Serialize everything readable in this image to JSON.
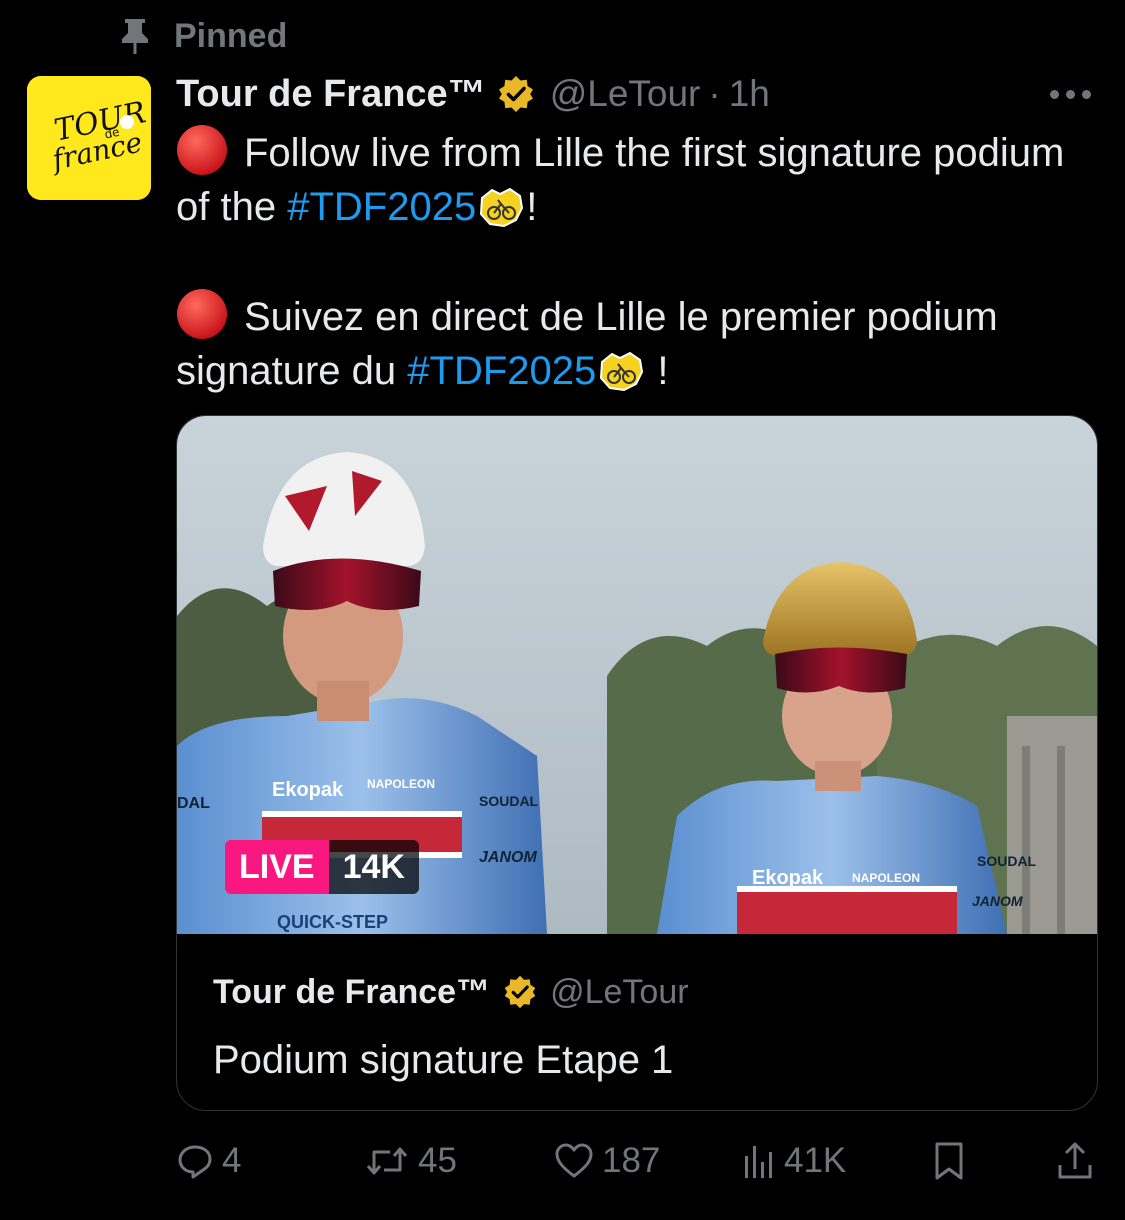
{
  "pinned": {
    "label": "Pinned",
    "icon": "pin-icon"
  },
  "author": {
    "name": "Tour de France™",
    "handle": "@LeTour",
    "separator": "·",
    "time": "1h",
    "verified_color": "#e8b828",
    "avatar_bg": "#ffe81c",
    "avatar_logo_lines": [
      "TOUR",
      "de",
      "france"
    ]
  },
  "tweet": {
    "line1_text": "Follow live from Lille the first signature podium of the ",
    "line1_tag": "#TDF2025",
    "line1_end": "!",
    "line2_text": "Suivez en direct de Lille le premier podium signature du ",
    "line2_tag": "#TDF2025",
    "line2_end": " !",
    "hashtag_color": "#1d9bf0"
  },
  "card": {
    "live_label": "LIVE",
    "viewer_count": "14K",
    "author": "Tour de France™",
    "handle": "@LeTour",
    "title": "Podium signature Etape 1",
    "live_color": "#f91880",
    "jersey_texts": {
      "sponsor_left": "Ekopak",
      "sponsor_napoleon": "NAPOLEON",
      "sponsor_soudal": "SOUDAL",
      "sponsor_janom": "JANOM",
      "sponsor_quickstep": "QUICK-STEP",
      "sponsor_dal": "DAL",
      "sponsor_ekopak_right": "Ekopak",
      "sponsor_napoleon_right": "NAPOLEON",
      "sponsor_soudal_right": "SOUDAL",
      "sponsor_janom_right": "JANOM"
    }
  },
  "actions": {
    "replies": "4",
    "reposts": "45",
    "likes": "187",
    "views": "41K"
  }
}
